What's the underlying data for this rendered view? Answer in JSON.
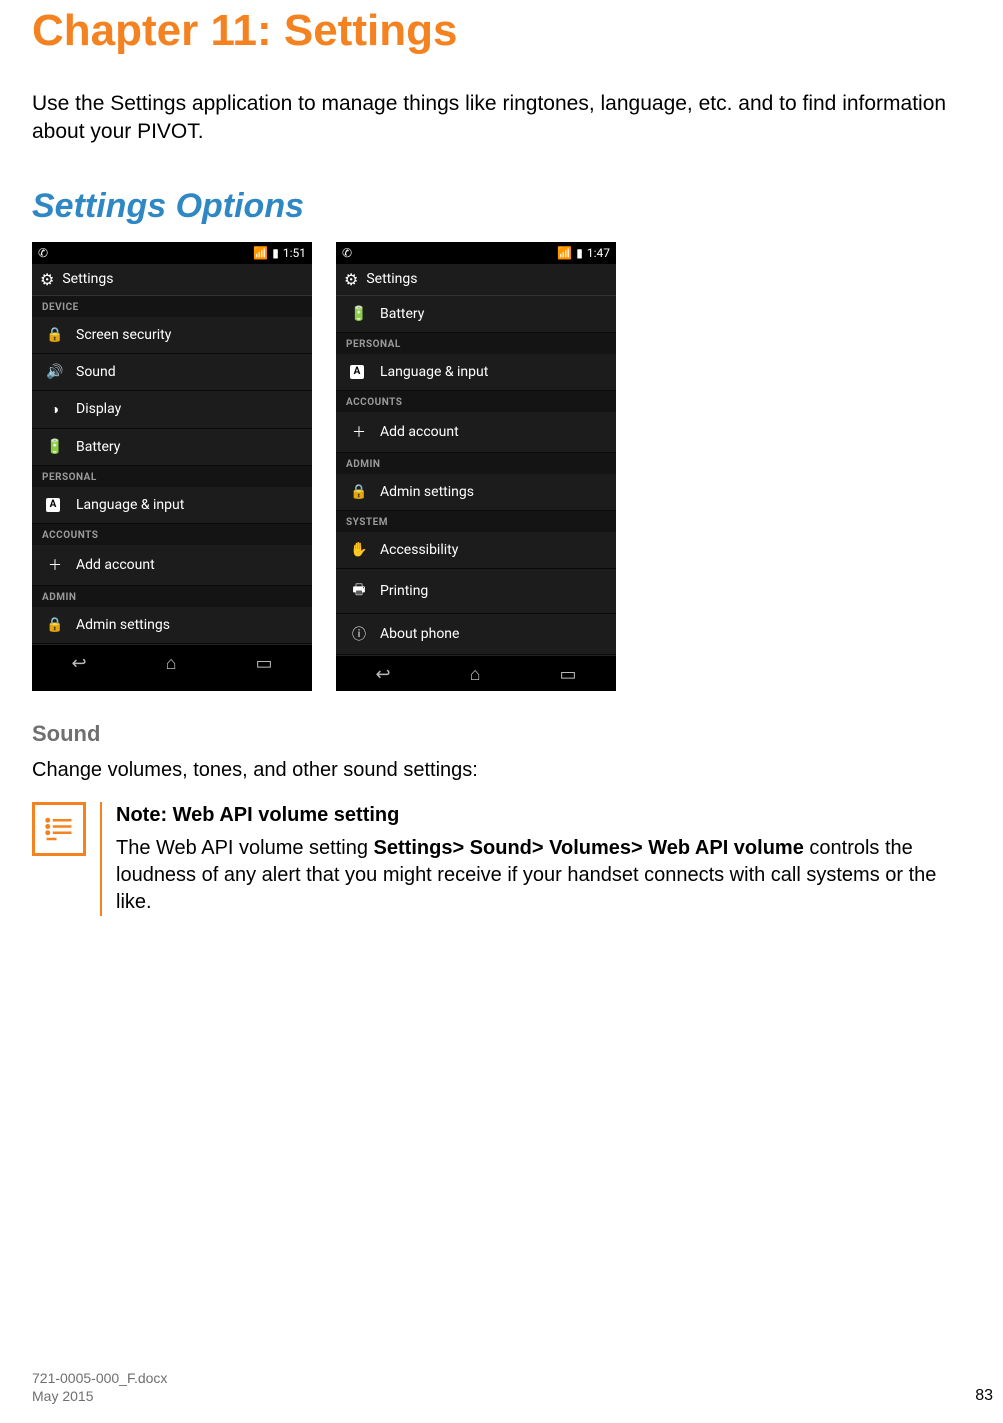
{
  "chapter_title": "Chapter 11: Settings",
  "intro": "Use the Settings application to manage things like ringtones, language, etc. and to find information about your PIVOT.",
  "section_title": "Settings Options",
  "phone1": {
    "time": "1:51",
    "app_title": "Settings",
    "groups": [
      {
        "header": "DEVICE",
        "items": [
          {
            "icon": "lock",
            "label": "Screen security"
          },
          {
            "icon": "sound",
            "label": "Sound"
          },
          {
            "icon": "display",
            "label": "Display"
          },
          {
            "icon": "battery",
            "label": "Battery"
          }
        ]
      },
      {
        "header": "PERSONAL",
        "items": [
          {
            "icon": "lang",
            "label": "Language & input"
          }
        ]
      },
      {
        "header": "ACCOUNTS",
        "items": [
          {
            "icon": "plus",
            "label": "Add account"
          }
        ]
      },
      {
        "header": "ADMIN",
        "items": [
          {
            "icon": "lock",
            "label": "Admin settings"
          }
        ]
      }
    ]
  },
  "phone2": {
    "time": "1:47",
    "app_title": "Settings",
    "groups": [
      {
        "header": "",
        "items": [
          {
            "icon": "battery",
            "label": "Battery"
          }
        ]
      },
      {
        "header": "PERSONAL",
        "items": [
          {
            "icon": "lang",
            "label": "Language & input"
          }
        ]
      },
      {
        "header": "ACCOUNTS",
        "items": [
          {
            "icon": "plus",
            "label": "Add account"
          }
        ]
      },
      {
        "header": "ADMIN",
        "items": [
          {
            "icon": "lock",
            "label": "Admin settings"
          }
        ]
      },
      {
        "header": "SYSTEM",
        "items": [
          {
            "icon": "hand",
            "label": "Accessibility"
          },
          {
            "icon": "print",
            "label": "Printing"
          },
          {
            "icon": "info",
            "label": "About phone"
          }
        ]
      }
    ]
  },
  "sub_heading": "Sound",
  "sound_text": "Change volumes, tones, and other sound settings:",
  "note": {
    "title": "Note: Web API volume setting",
    "pre": "The Web API volume setting ",
    "bold": "Settings> Sound> Volumes> Web API volume",
    "post": " controls the loudness of any alert that you might receive if your handset connects with call systems or the like."
  },
  "footer": {
    "doc": "721-0005-000_F.docx",
    "date": "May 2015",
    "page": "83"
  },
  "icons": {
    "lock": "🔒",
    "sound": "🔊",
    "display": "◑",
    "battery": "🔋",
    "plus": "＋",
    "hand": "✋",
    "print": "🖶",
    "info": "ⓘ",
    "phone": "✆",
    "wifi": "📶",
    "batt_sb": "▮",
    "back": "↩",
    "home": "⌂",
    "recent": "▭",
    "gear": "⚙"
  }
}
